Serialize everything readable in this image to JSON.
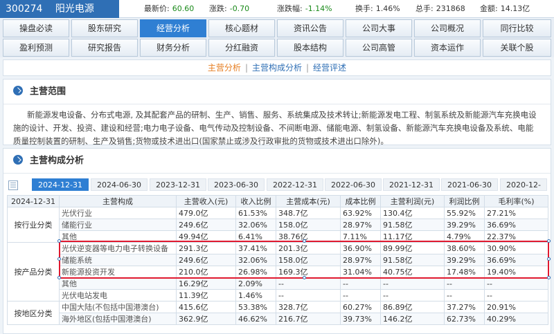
{
  "header": {
    "code": "300274",
    "name": "阳光电源",
    "quotes": [
      {
        "label": "最新价:",
        "value": "60.60"
      },
      {
        "label": "涨跌:",
        "value": "-0.70"
      },
      {
        "label": "涨跌幅:",
        "value": "-1.14%"
      },
      {
        "label": "换手:",
        "value": "1.46%"
      },
      {
        "label": "总手:",
        "value": "231868"
      },
      {
        "label": "金额:",
        "value": "14.13亿"
      }
    ]
  },
  "nav": {
    "row1": [
      "操盘必读",
      "股东研究",
      "经营分析",
      "核心题材",
      "资讯公告",
      "公司大事",
      "公司概况",
      "同行比较"
    ],
    "row2": [
      "盈利预测",
      "研究报告",
      "财务分析",
      "分红融资",
      "股本结构",
      "公司高管",
      "资本运作",
      "关联个股"
    ],
    "active": "经营分析"
  },
  "subnav": [
    "主营分析",
    "主营构成分析",
    "经营评述"
  ],
  "scope": {
    "title": "主营范围",
    "text": "新能源发电设备、分布式电源, 及其配套产品的研制、生产、销售、服务、系统集成及技术转让;新能源发电工程、制氢系统及新能源汽车充换电设施的设计、开发、投资、建设和经营;电力电子设备、电气传动及控制设备、不间断电源、储能电源、制氢设备、新能源汽车充换电设备及系统、电能质量控制装置的研制、生产及销售;货物或技术进出口(国家禁止或涉及行政审批的货物或技术进出口除外)。"
  },
  "composition": {
    "title": "主营构成分析",
    "dates": [
      "2024-12-31",
      "2024-06-30",
      "2023-12-31",
      "2023-06-30",
      "2022-12-31",
      "2022-06-30",
      "2021-12-31",
      "2021-06-30",
      "2020-12-"
    ],
    "headers": [
      "2024-12-31",
      "主营构成",
      "主营收入(元)",
      "收入比例",
      "主营成本(元)",
      "成本比例",
      "主营利润(元)",
      "利润比例",
      "毛利率(%)"
    ],
    "groups": [
      {
        "category": "按行业分类",
        "rows": [
          [
            "光伏行业",
            "479.0亿",
            "61.53%",
            "348.7亿",
            "63.92%",
            "130.4亿",
            "55.92%",
            "27.21%"
          ],
          [
            "储能行业",
            "249.6亿",
            "32.06%",
            "158.0亿",
            "28.97%",
            "91.58亿",
            "39.29%",
            "36.69%"
          ],
          [
            "其他",
            "49.94亿",
            "6.41%",
            "38.76亿",
            "7.11%",
            "11.17亿",
            "4.79%",
            "22.37%"
          ]
        ]
      },
      {
        "category": "按产品分类",
        "rows": [
          [
            "光伏逆变器等电力电子转换设备",
            "291.3亿",
            "37.41%",
            "201.3亿",
            "36.90%",
            "89.99亿",
            "38.60%",
            "30.90%"
          ],
          [
            "储能系统",
            "249.6亿",
            "32.06%",
            "158.0亿",
            "28.97%",
            "91.58亿",
            "39.29%",
            "36.69%"
          ],
          [
            "新能源投资开发",
            "210.0亿",
            "26.98%",
            "169.3亿",
            "31.04%",
            "40.75亿",
            "17.48%",
            "19.40%"
          ],
          [
            "其他",
            "16.29亿",
            "2.09%",
            "--",
            "--",
            "--",
            "--",
            "--"
          ],
          [
            "光伏电站发电",
            "11.39亿",
            "1.46%",
            "--",
            "--",
            "--",
            "--",
            "--"
          ]
        ]
      },
      {
        "category": "按地区分类",
        "rows": [
          [
            "中国大陆(不包括中国港澳台)",
            "415.6亿",
            "53.38%",
            "328.7亿",
            "60.27%",
            "86.89亿",
            "37.27%",
            "20.91%"
          ],
          [
            "海外地区(包括中国港澳台)",
            "362.9亿",
            "46.62%",
            "216.7亿",
            "39.73%",
            "146.2亿",
            "62.73%",
            "40.29%"
          ]
        ]
      }
    ]
  },
  "colors": {
    "accent": "#2f7fd3",
    "highlight": "#e0192f",
    "current_link": "#e67e22"
  }
}
